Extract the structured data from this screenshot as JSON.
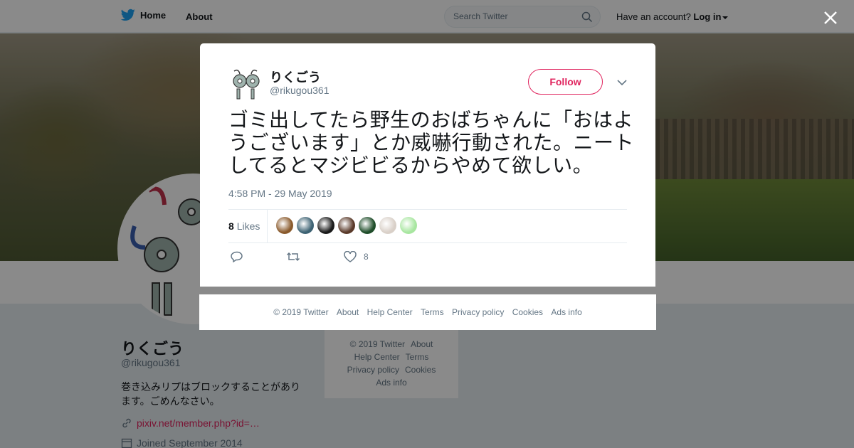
{
  "topbar": {
    "home_label": "Home",
    "about_label": "About",
    "search_placeholder": "Search Twitter",
    "account_prompt": "Have an account?",
    "login_label": "Log in"
  },
  "profile": {
    "name": "りくごう",
    "handle": "@rikugou361",
    "bio": "巻き込みリプはブロックすることがあります。ごめんなさい。",
    "link": "pixiv.net/member.php?id=…",
    "joined": "Joined September 2014"
  },
  "side_footer": {
    "row1": [
      "© 2019 Twitter",
      "About"
    ],
    "row2": [
      "Help Center",
      "Terms"
    ],
    "row3": [
      "Privacy policy",
      "Cookies"
    ],
    "row4": [
      "Ads info"
    ]
  },
  "tweet": {
    "author_name": "りくごう",
    "author_handle": "@rikugou361",
    "follow_label": "Follow",
    "text": "ゴミ出してたら野生のおばちゃんに「おはようございます」とか威嚇行動された。ニートしてるとマジビビるからやめて欲しい。",
    "timestamp": "4:58 PM - 29 May 2019",
    "likes_count": "8",
    "likes_label": "Likes",
    "like_action_count": "8",
    "liker_colors": [
      "#8a5a2c",
      "#3d6273",
      "#1a1a1a",
      "#5a3a2a",
      "#1f4d2a",
      "#d9d0c8",
      "#a8e6a0"
    ]
  },
  "modal_footer": {
    "links": [
      "© 2019 Twitter",
      "About",
      "Help Center",
      "Terms",
      "Privacy policy",
      "Cookies",
      "Ads info"
    ]
  },
  "colors": {
    "brand_blue": "#1da1f2",
    "follow_accent": "#e0245e",
    "muted_text": "#657786"
  }
}
